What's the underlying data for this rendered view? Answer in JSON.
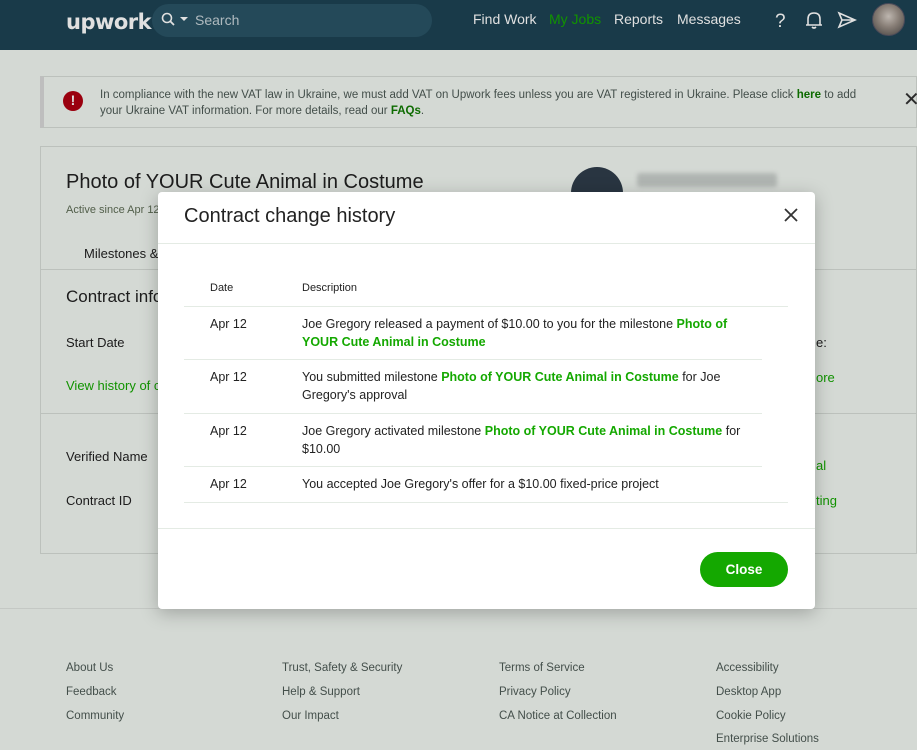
{
  "header": {
    "logo": "upwork",
    "search_placeholder": "Search",
    "nav": [
      "Find Work",
      "My Jobs",
      "Reports",
      "Messages"
    ]
  },
  "notice": {
    "text_before": "In compliance with the new VAT law in Ukraine, we must add VAT on Upwork fees unless you are VAT registered in Ukraine. Please click ",
    "link_here": "here",
    "text_middle": " to add your Ukraine VAT information. For more details, read our ",
    "link_faqs": "FAQs",
    "text_end": "."
  },
  "contract_card": {
    "title": "Photo of YOUR Cute Animal in Costume",
    "subtitle": "Active since Apr 12",
    "tab": "Milestones &",
    "section_title": "Contract info",
    "start_date_label": "Start Date",
    "view_history_link": "View history of c",
    "verified_name_label": "Verified Name",
    "contract_id_label": "Contract ID",
    "client_name": "Joe Gregory",
    "side_fragments": [
      "e:",
      "ore",
      "al",
      "ting"
    ]
  },
  "modal": {
    "title": "Contract change history",
    "col_date": "Date",
    "col_description": "Description",
    "rows": [
      {
        "date": "Apr 12",
        "pre": "Joe Gregory released a payment of $10.00 to you for the milestone ",
        "link": "Photo of YOUR Cute Animal in Costume",
        "post": ""
      },
      {
        "date": "Apr 12",
        "pre": "You submitted milestone ",
        "link": "Photo of YOUR Cute Animal in Costume",
        "post": " for Joe Gregory's approval"
      },
      {
        "date": "Apr 12",
        "pre": "Joe Gregory activated milestone ",
        "link": "Photo of YOUR Cute Animal in Costume",
        "post": " for $10.00"
      },
      {
        "date": "Apr 12",
        "pre": "You accepted Joe Gregory's offer for a $10.00 fixed-price project",
        "link": "",
        "post": ""
      }
    ],
    "close_label": "Close"
  },
  "footer": {
    "col1": [
      "About Us",
      "Feedback",
      "Community"
    ],
    "col2": [
      "Trust, Safety & Security",
      "Help & Support",
      "Our Impact"
    ],
    "col3": [
      "Terms of Service",
      "Privacy Policy",
      "CA Notice at Collection"
    ],
    "col4": [
      "Accessibility",
      "Desktop App",
      "Cookie Policy",
      "Enterprise Solutions"
    ]
  },
  "colors": {
    "header_bg": "#1d4354",
    "accent_green": "#14a800",
    "error_red": "#b00010"
  }
}
